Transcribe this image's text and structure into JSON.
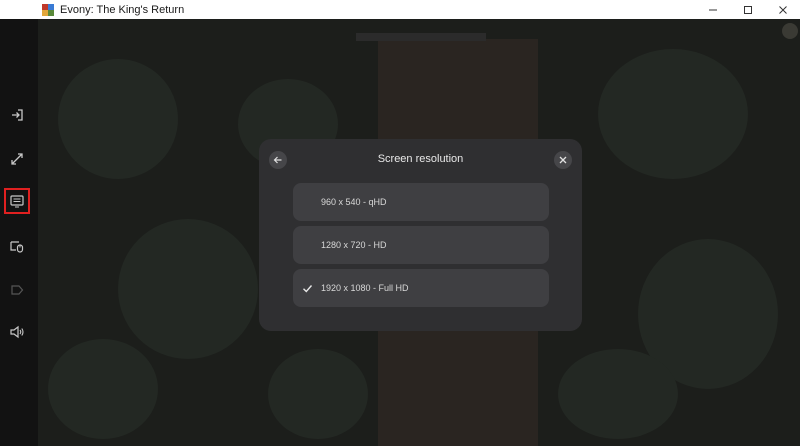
{
  "window": {
    "title": "Evony: The King's Return",
    "controls": {
      "minimize": "—",
      "maximize": "☐",
      "close": "✕"
    }
  },
  "sidebar": {
    "items": [
      {
        "name": "sign-in-icon",
        "active": false
      },
      {
        "name": "expand-icon",
        "active": false
      },
      {
        "name": "screen-resolution-icon",
        "active": true
      },
      {
        "name": "mouse-lock-icon",
        "active": false
      },
      {
        "name": "tag-icon",
        "active": false,
        "disabled": true
      },
      {
        "name": "volume-icon",
        "active": false
      }
    ]
  },
  "dialog": {
    "title": "Screen resolution",
    "back_icon": "arrow-left-icon",
    "close_icon": "close-icon",
    "options": [
      {
        "label": "960 x 540 - qHD",
        "selected": false
      },
      {
        "label": "1280 x 720 - HD",
        "selected": false
      },
      {
        "label": "1920 x 1080 - Full HD",
        "selected": true
      }
    ]
  },
  "colors": {
    "active_outline": "#e02020",
    "dialog_bg": "#2f2f31",
    "option_bg": "#3f3f42"
  }
}
